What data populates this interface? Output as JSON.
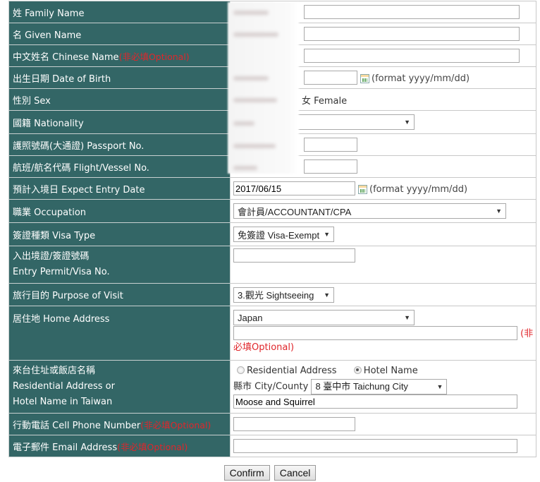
{
  "form": {
    "rows": {
      "family_name": {
        "label": "姓 Family Name"
      },
      "given_name": {
        "label": "名 Given Name"
      },
      "chinese_name": {
        "label": "中文姓名 Chinese Name",
        "optional": "(非必填Optional)"
      },
      "dob": {
        "label": "出生日期 Date of Birth",
        "format_hint": "(format yyyy/mm/dd)"
      },
      "sex": {
        "label": "性別 Sex",
        "female_label": "女 Female"
      },
      "nationality": {
        "label": "國籍 Nationality"
      },
      "passport": {
        "label": "護照號碼(大通證) Passport No."
      },
      "flight": {
        "label": "航班/航名代碼 Flight/Vessel No."
      },
      "entry_date": {
        "label": "預計入境日 Expect Entry Date",
        "value": "2017/06/15",
        "format_hint": "(format yyyy/mm/dd)"
      },
      "occupation": {
        "label": "職業 Occupation",
        "selected": "會計員/ACCOUNTANT/CPA"
      },
      "visa_type": {
        "label": "簽證種類 Visa Type",
        "selected": "免簽證 Visa-Exempt"
      },
      "entry_permit": {
        "label_line1": "入出境證/簽證號碼",
        "label_line2": "Entry Permit/Visa No.",
        "value": ""
      },
      "purpose": {
        "label": "旅行目的 Purpose of Visit",
        "selected": "3.觀光 Sightseeing"
      },
      "home_address": {
        "label": "居住地 Home Address",
        "country_selected": "Japan",
        "address_value": "",
        "optional_part1": "(非",
        "optional_part2": "必填Optional)"
      },
      "taiwan_address": {
        "label_line1": "來台住址或飯店名稱",
        "label_line2": "Residential Address or",
        "label_line3": "Hotel Name in Taiwan",
        "radio_residential": "Residential Address",
        "radio_hotel": "Hotel Name",
        "selected_radio": "Hotel Name",
        "city_label": "縣市 City/County",
        "city_selected": "8 臺中市 Taichung City",
        "hotel_value": "Moose and Squirrel"
      },
      "cell_phone": {
        "label": "行動電話 Cell Phone Number",
        "optional": "(非必填Optional)",
        "value": ""
      },
      "email": {
        "label": "電子郵件 Email Address",
        "optional": "(非必填Optional)",
        "value": ""
      }
    },
    "buttons": {
      "confirm": "Confirm",
      "cancel": "Cancel"
    }
  },
  "colors": {
    "label_bg": "#336666",
    "optional_red": "#e0262b"
  }
}
